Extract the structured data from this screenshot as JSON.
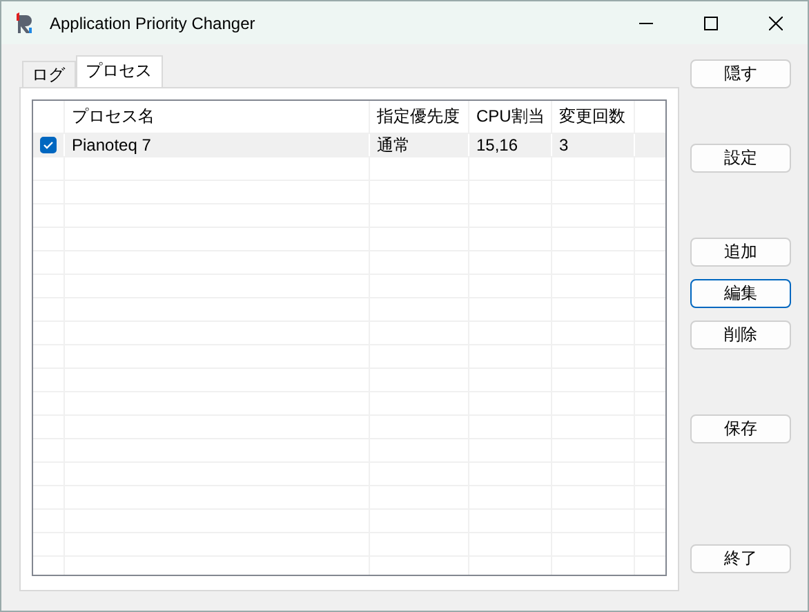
{
  "window": {
    "title": "Application Priority Changer"
  },
  "tabs": [
    {
      "label": "ログ",
      "selected": false
    },
    {
      "label": "プロセス",
      "selected": true
    }
  ],
  "table": {
    "columns": [
      "プロセス名",
      "指定優先度",
      "CPU割当",
      "変更回数"
    ],
    "rows": [
      {
        "checked": true,
        "cells": [
          "Pianoteq 7",
          "通常",
          "15,16",
          "3"
        ]
      }
    ]
  },
  "buttons": [
    {
      "label": "隠す",
      "focused": false
    },
    {
      "label": "設定",
      "focused": false
    },
    {
      "label": "追加",
      "focused": false
    },
    {
      "label": "編集",
      "focused": true
    },
    {
      "label": "削除",
      "focused": false
    },
    {
      "label": "保存",
      "focused": false
    },
    {
      "label": "終了",
      "focused": false
    }
  ]
}
